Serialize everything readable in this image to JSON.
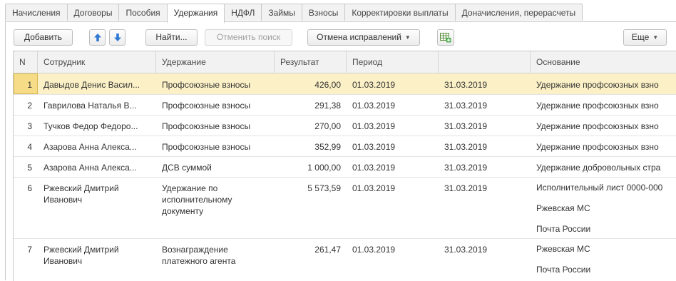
{
  "tabs": [
    {
      "label": "Начисления"
    },
    {
      "label": "Договоры"
    },
    {
      "label": "Пособия"
    },
    {
      "label": "Удержания"
    },
    {
      "label": "НДФЛ"
    },
    {
      "label": "Займы"
    },
    {
      "label": "Взносы"
    },
    {
      "label": "Корректировки выплаты"
    },
    {
      "label": "Доначисления, перерасчеты"
    }
  ],
  "active_tab": "Удержания",
  "toolbar": {
    "add": "Добавить",
    "find": "Найти...",
    "cancel_search": "Отменить поиск",
    "cancel_corrections": "Отмена исправлений",
    "more": "Еще"
  },
  "columns": {
    "n": "N",
    "employee": "Сотрудник",
    "deduction": "Удержание",
    "result": "Результат",
    "period": "Период",
    "period_end": "",
    "basis": "Основание"
  },
  "rows": [
    {
      "n": "1",
      "employee": "Давыдов Денис Васил...",
      "deduction": "Профсоюзные взносы",
      "result": "426,00",
      "from": "01.03.2019",
      "to": "31.03.2019",
      "basis": [
        "Удержание профсоюзных взно"
      ]
    },
    {
      "n": "2",
      "employee": "Гаврилова Наталья В...",
      "deduction": "Профсоюзные взносы",
      "result": "291,38",
      "from": "01.03.2019",
      "to": "31.03.2019",
      "basis": [
        "Удержание профсоюзных взно"
      ]
    },
    {
      "n": "3",
      "employee": "Тучков Федор Федоро...",
      "deduction": "Профсоюзные взносы",
      "result": "270,00",
      "from": "01.03.2019",
      "to": "31.03.2019",
      "basis": [
        "Удержание профсоюзных взно"
      ]
    },
    {
      "n": "4",
      "employee": "Азарова Анна Алекса...",
      "deduction": "Профсоюзные взносы",
      "result": "352,99",
      "from": "01.03.2019",
      "to": "31.03.2019",
      "basis": [
        "Удержание профсоюзных взно"
      ]
    },
    {
      "n": "5",
      "employee": "Азарова Анна Алекса...",
      "deduction": "ДСВ суммой",
      "result": "1 000,00",
      "from": "01.03.2019",
      "to": "31.03.2019",
      "basis": [
        "Удержание добровольных стра"
      ]
    },
    {
      "n": "6",
      "employee": "Ржевский Дмитрий Иванович",
      "deduction": "Удержание по исполнительному документу",
      "result": "5 573,59",
      "from": "01.03.2019",
      "to": "31.03.2019",
      "basis": [
        "Исполнительный лист 0000-000",
        "Ржевская МС",
        "Почта России"
      ]
    },
    {
      "n": "7",
      "employee": "Ржевский Дмитрий Иванович",
      "deduction": "Вознаграждение платежного агента",
      "result": "261,47",
      "from": "01.03.2019",
      "to": "31.03.2019",
      "basis": [
        "Ржевская МС",
        "Почта России"
      ]
    }
  ],
  "selected_row": 1,
  "colors": {
    "selection": "#fbf0c6",
    "accent_arrow": "#2f79d4",
    "header_bg": "#f2f2f2"
  }
}
